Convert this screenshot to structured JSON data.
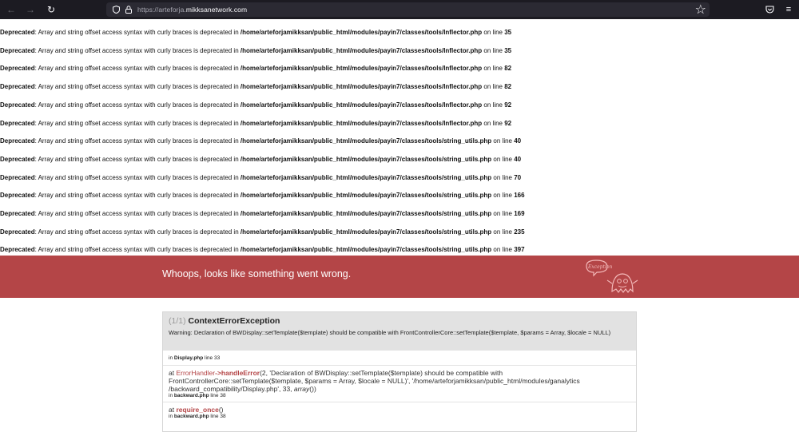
{
  "browser": {
    "url_scheme": "https://",
    "url_host_prefix": "arteforja.",
    "url_host_main": "mikksanetwork.com"
  },
  "deprecated": {
    "label": "Deprecated",
    "message": ": Array and string offset access syntax with curly braces is deprecated in ",
    "on_line": " on line ",
    "items": [
      {
        "path": "/home/arteforjamikksan/public_html/modules/payin7/classes/tools/Inflector.php",
        "line": "35"
      },
      {
        "path": "/home/arteforjamikksan/public_html/modules/payin7/classes/tools/Inflector.php",
        "line": "35"
      },
      {
        "path": "/home/arteforjamikksan/public_html/modules/payin7/classes/tools/Inflector.php",
        "line": "82"
      },
      {
        "path": "/home/arteforjamikksan/public_html/modules/payin7/classes/tools/Inflector.php",
        "line": "82"
      },
      {
        "path": "/home/arteforjamikksan/public_html/modules/payin7/classes/tools/Inflector.php",
        "line": "92"
      },
      {
        "path": "/home/arteforjamikksan/public_html/modules/payin7/classes/tools/Inflector.php",
        "line": "92"
      },
      {
        "path": "/home/arteforjamikksan/public_html/modules/payin7/classes/tools/string_utils.php",
        "line": "40"
      },
      {
        "path": "/home/arteforjamikksan/public_html/modules/payin7/classes/tools/string_utils.php",
        "line": "40"
      },
      {
        "path": "/home/arteforjamikksan/public_html/modules/payin7/classes/tools/string_utils.php",
        "line": "70"
      },
      {
        "path": "/home/arteforjamikksan/public_html/modules/payin7/classes/tools/string_utils.php",
        "line": "166"
      },
      {
        "path": "/home/arteforjamikksan/public_html/modules/payin7/classes/tools/string_utils.php",
        "line": "169"
      },
      {
        "path": "/home/arteforjamikksan/public_html/modules/payin7/classes/tools/string_utils.php",
        "line": "235"
      },
      {
        "path": "/home/arteforjamikksan/public_html/modules/payin7/classes/tools/string_utils.php",
        "line": "397"
      }
    ]
  },
  "whoops": {
    "headline": "Whoops, looks like something went wrong.",
    "badge_text": "Exception"
  },
  "exception": {
    "count": "(1/1)",
    "class": "ContextErrorException",
    "message": "Warning: Declaration of BWDisplay::setTemplate($template) should be compatible with FrontControllerCore::setTemplate($template, $params = Array, $locale = NULL)",
    "first_location_prefix": "in ",
    "first_location_file": "Display.php",
    "first_location_line": " line 33",
    "trace": [
      {
        "at": "at ",
        "class": "ErrorHandler",
        "arrow": "->",
        "function": "handleError",
        "args_line1": "(2, 'Declaration of BWDisplay::setTemplate($template) should be compatible with",
        "args_line2": "FrontControllerCore::setTemplate($template, $params = Array, $locale = NULL)', '/home/arteforjamikksan/public_html/modules/ganalytics",
        "args_line3_a": "/backward_compatibility/Display.php', 33, ",
        "args_line3_b": "array",
        "args_line3_c": "())",
        "loc_prefix": "in ",
        "loc_file": "backward.php",
        "loc_line": " line 38"
      },
      {
        "at": "at ",
        "function": "require_once",
        "args": "()",
        "loc_prefix": "in ",
        "loc_file": "backward.php",
        "loc_line": " line 38"
      }
    ]
  }
}
